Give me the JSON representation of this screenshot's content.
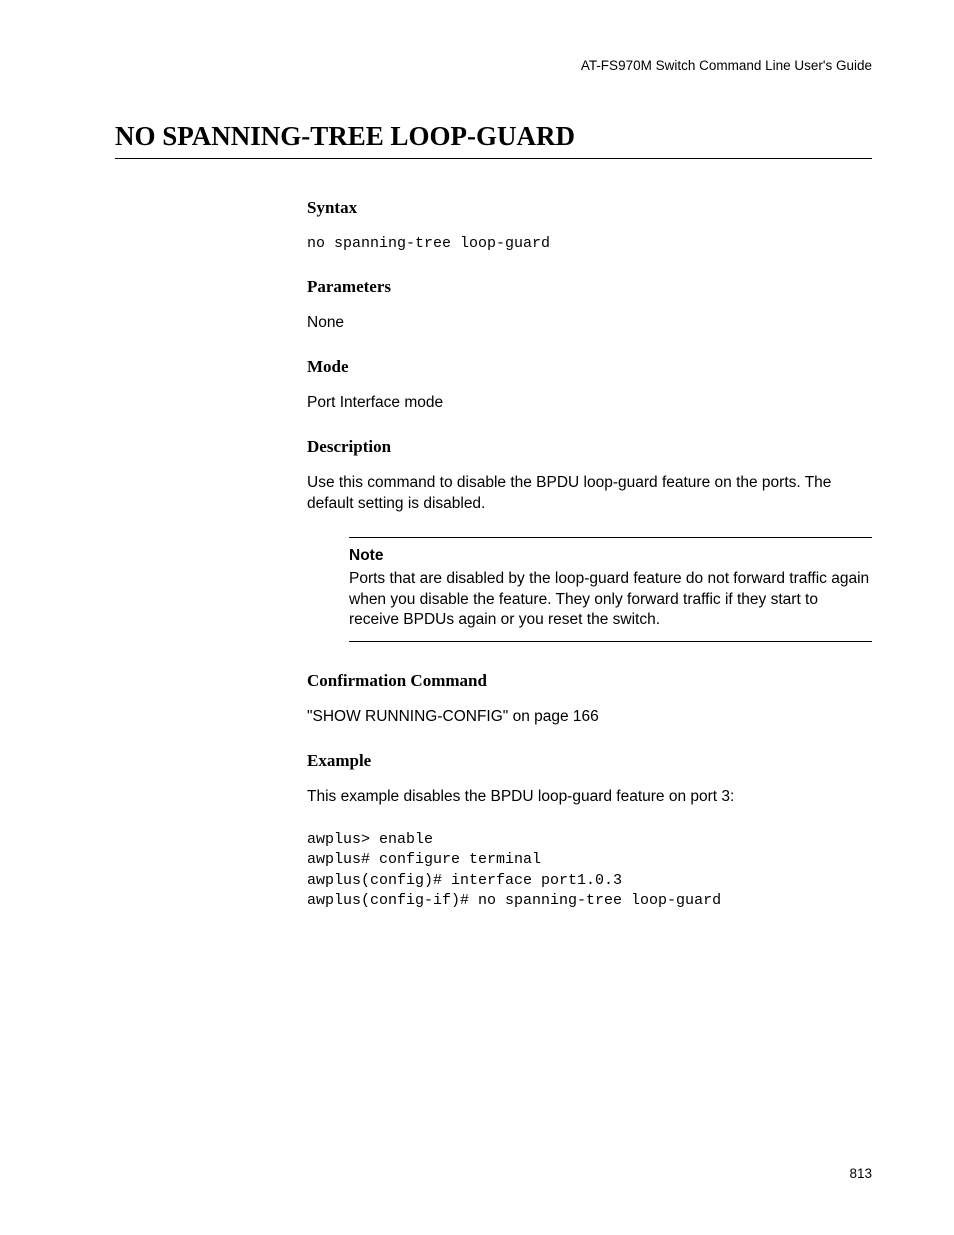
{
  "header": {
    "guide_title": "AT-FS970M Switch Command Line User's Guide"
  },
  "page_title": "NO SPANNING-TREE LOOP-GUARD",
  "sections": {
    "syntax": {
      "heading": "Syntax",
      "code": "no spanning-tree loop-guard"
    },
    "parameters": {
      "heading": "Parameters",
      "text": "None"
    },
    "mode": {
      "heading": "Mode",
      "text": "Port Interface mode"
    },
    "description": {
      "heading": "Description",
      "text": "Use this command to disable the BPDU loop-guard feature on the ports. The default setting is disabled."
    },
    "note": {
      "label": "Note",
      "text": "Ports that are disabled by the loop-guard feature do not forward traffic again when you disable the feature. They only forward traffic if they start to receive BPDUs again or you reset the switch."
    },
    "confirmation": {
      "heading": "Confirmation Command",
      "text": "\"SHOW RUNNING-CONFIG\" on page 166"
    },
    "example": {
      "heading": "Example",
      "text": "This example disables the BPDU loop-guard feature on port 3:",
      "code": "awplus> enable\nawplus# configure terminal\nawplus(config)# interface port1.0.3\nawplus(config-if)# no spanning-tree loop-guard"
    }
  },
  "page_number": "813"
}
